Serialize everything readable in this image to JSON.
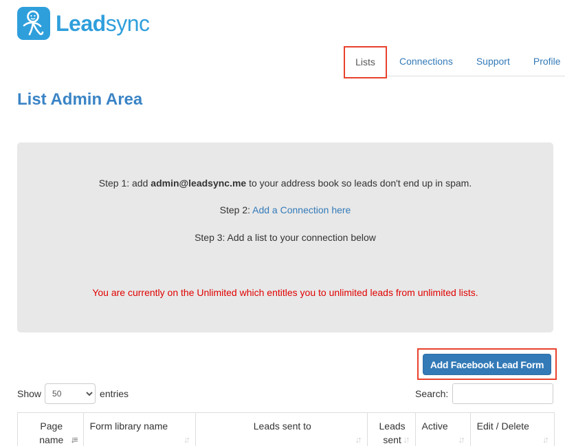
{
  "brand": {
    "name_bold": "Lead",
    "name_light": "sync",
    "logo_color": "#2f9fdc"
  },
  "nav": {
    "items": [
      {
        "label": "Lists",
        "active": true
      },
      {
        "label": "Connections",
        "active": false
      },
      {
        "label": "Support",
        "active": false
      },
      {
        "label": "Profile",
        "active": false
      }
    ]
  },
  "page": {
    "title": "List Admin Area"
  },
  "info": {
    "step1_prefix": "Step 1: add ",
    "step1_email": "admin@leadsync.me",
    "step1_suffix": " to your address book so leads don't end up in spam.",
    "step2_prefix": "Step 2: ",
    "step2_link": "Add a Connection here",
    "step3": "Step 3: Add a list to your connection below",
    "plan_notice": "You are currently on the Unlimited which entitles you to unlimited leads from unlimited lists."
  },
  "actions": {
    "add_button": "Add Facebook Lead Form"
  },
  "table_controls": {
    "show_label": "Show",
    "entries_value": "50",
    "entries_label": "entries",
    "search_label": "Search:",
    "search_value": ""
  },
  "table": {
    "columns": [
      {
        "line1": "Page",
        "line2": "name"
      },
      {
        "line1": "Form library name",
        "line2": ""
      },
      {
        "line1": "Leads sent to",
        "line2": ""
      },
      {
        "line1": "Leads",
        "line2": "sent"
      },
      {
        "line1": "Active",
        "line2": ""
      },
      {
        "line1": "Edit / Delete",
        "line2": ""
      }
    ]
  },
  "colors": {
    "accent": "#337ab7",
    "title": "#3a84c5",
    "highlight_border": "#e8412c",
    "notice": "#e10000"
  }
}
